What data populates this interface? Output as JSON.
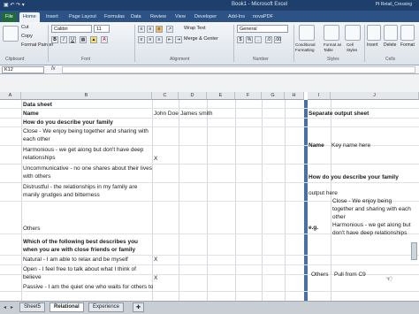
{
  "window": {
    "title": "Book1 - Microsoft Excel",
    "user": "Pt Retail_Cressing"
  },
  "ribbon_tabs": [
    "File",
    "Home",
    "Insert",
    "Page Layout",
    "Formulas",
    "Data",
    "Review",
    "View",
    "Developer",
    "Add-Ins",
    "novaPDF"
  ],
  "clipboard": {
    "cut": "Cut",
    "copy": "Copy",
    "format_painter": "Format Painter",
    "label": "Clipboard"
  },
  "font": {
    "name": "Calibri",
    "size": "11",
    "label": "Font"
  },
  "alignment": {
    "wrap_text": "Wrap Text",
    "merge_center": "Merge & Center",
    "label": "Alignment"
  },
  "number": {
    "format": "General",
    "label": "Number",
    "percent": "%",
    "comma": ","
  },
  "styles": {
    "conditional": "Conditional Formatting",
    "format_table": "Format as Table",
    "cell_styles": "Cell Styles",
    "label": "Styles"
  },
  "cells": {
    "insert": "Insert",
    "delete": "Delete",
    "format": "Format",
    "label": "Cells"
  },
  "formula_bar": {
    "name_box": "K12",
    "fx": "fx",
    "content": ""
  },
  "columns": [
    "A",
    "B",
    "C",
    "D",
    "E",
    "F",
    "G",
    "H",
    "I",
    "J"
  ],
  "sheet": {
    "data_sheet_title": "Data sheet",
    "name_label": "Name",
    "col_c_header": "John Doe",
    "col_d_header": "James smith",
    "q1": "How do you describe your family",
    "close": "Close - We enjoy being together and sharing with each other",
    "harmonious": "Harmonious - we get along but don't have deep relationships",
    "uncommunicative": "Uncommunicative - no one shares about their lives with others",
    "distrustful": "Distrustful - the relationships in my family are manily grudges and bitterness",
    "others": "Others",
    "q2": "Which of the following best describes you when you are with close friends or family",
    "natural": "Natural - I am able to relax and be myself",
    "open": "Open - I feel free to talk about what I think of believe",
    "passive": "Passive - I am the quiet one who waits for others to",
    "x_mark": "X",
    "output_title": "Separate output sheet",
    "out_name": "Name",
    "out_key": "Key name here",
    "out_q": "How do you describe your family",
    "out_here": "output here",
    "out_close": "Close - We enjoy being together and sharing with each other",
    "eg": "e.g.",
    "out_harmonious": "Harmonious - we get along but don't have deep relationships",
    "out_others": "Others",
    "out_pull": "Pull from C9"
  },
  "sheet_tabs": [
    "Sheet5",
    "Relational",
    "Experience"
  ],
  "active_sheet_tab": "Relational"
}
